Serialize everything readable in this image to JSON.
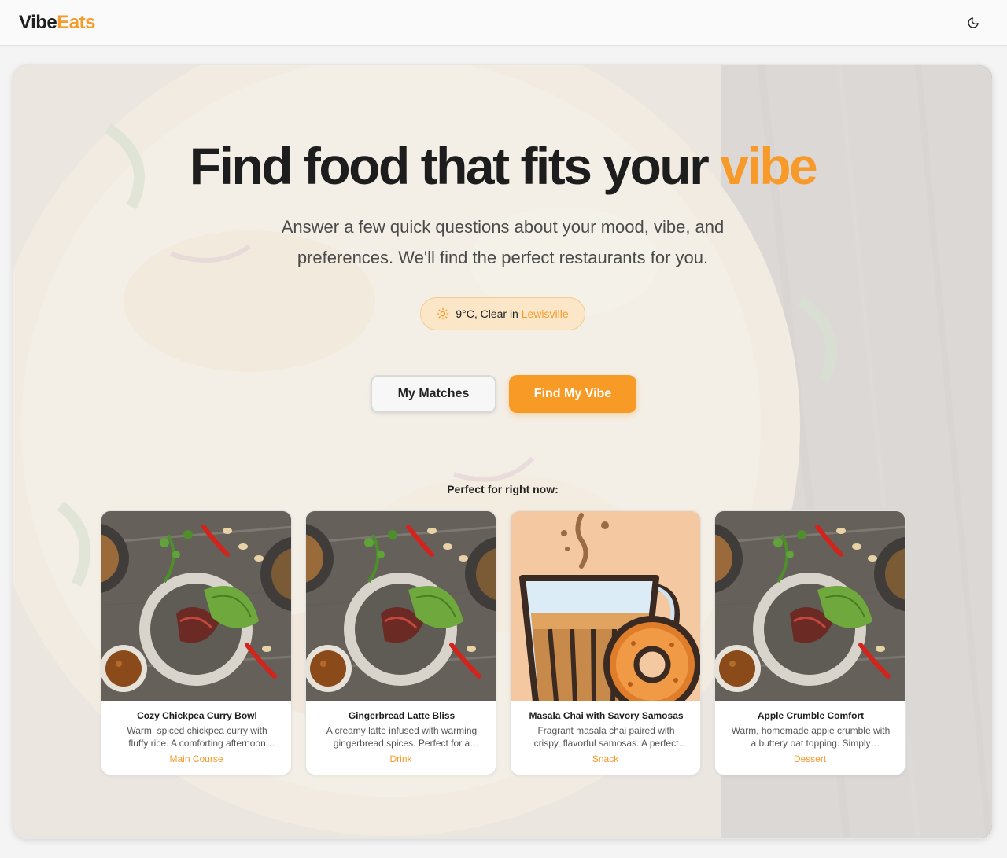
{
  "header": {
    "logo_part1": "Vibe",
    "logo_part2": "Eats",
    "theme_icon": "moon-icon"
  },
  "hero": {
    "headline_main": "Find food that fits your ",
    "headline_accent": "vibe",
    "subtitle": "Answer a few quick questions about your mood, vibe, and preferences. We'll find the perfect restaurants for you.",
    "weather": {
      "icon": "sun-icon",
      "text": "9°C, Clear in ",
      "city": "Lewisville"
    },
    "buttons": {
      "matches_label": "My Matches",
      "find_label": "Find My Vibe"
    }
  },
  "suggestions": {
    "heading": "Perfect for right now:",
    "items": [
      {
        "title": "Cozy Chickpea Curry Bowl",
        "description": "Warm, spiced chickpea curry with fluffy rice. A comforting afternoon treat.",
        "category": "Main Course",
        "image": "food-bowl-photo"
      },
      {
        "title": "Gingerbread Latte Bliss",
        "description": "A creamy latte infused with warming gingerbread spices. Perfect for a chilly day.",
        "category": "Drink",
        "image": "food-bowl-photo"
      },
      {
        "title": "Masala Chai with Savory Samosas",
        "description": "Fragrant masala chai paired with crispy, flavorful samosas. A perfect pairing.",
        "category": "Snack",
        "image": "chai-illustration"
      },
      {
        "title": "Apple Crumble Comfort",
        "description": "Warm, homemade apple crumble with a buttery oat topping. Simply delightful.",
        "category": "Dessert",
        "image": "food-bowl-photo"
      }
    ]
  },
  "colors": {
    "accent": "#f79a2a",
    "button_primary": "#f89b26",
    "weather_pill_bg": "#fbe7c8"
  }
}
